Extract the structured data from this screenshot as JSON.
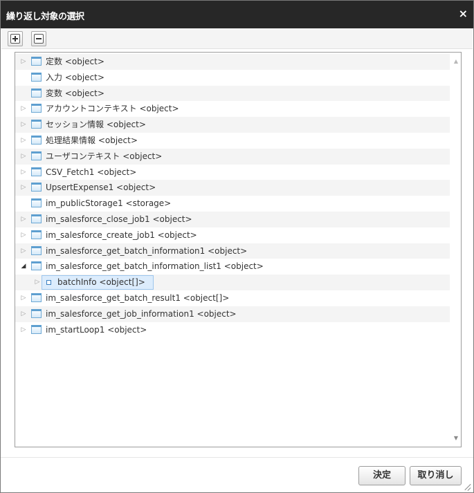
{
  "dialog": {
    "title": "繰り返し対象の選択",
    "close_glyph": "×"
  },
  "toolbar": {
    "expand_icon": "plus-box-icon",
    "collapse_icon": "minus-box-icon"
  },
  "tree": {
    "items": [
      {
        "label": "定数 <object>",
        "expander": "▷"
      },
      {
        "label": "入力 <object>",
        "expander": ""
      },
      {
        "label": "変数 <object>",
        "expander": ""
      },
      {
        "label": "アカウントコンテキスト <object>",
        "expander": "▷"
      },
      {
        "label": "セッション情報 <object>",
        "expander": "▷"
      },
      {
        "label": "処理結果情報 <object>",
        "expander": "▷"
      },
      {
        "label": "ユーザコンテキスト <object>",
        "expander": "▷"
      },
      {
        "label": "CSV_Fetch1 <object>",
        "expander": "▷"
      },
      {
        "label": "UpsertExpense1 <object>",
        "expander": "▷"
      },
      {
        "label": "im_publicStorage1 <storage>",
        "expander": ""
      },
      {
        "label": "im_salesforce_close_job1 <object>",
        "expander": "▷"
      },
      {
        "label": "im_salesforce_create_job1 <object>",
        "expander": "▷"
      },
      {
        "label": "im_salesforce_get_batch_information1 <object>",
        "expander": "▷"
      },
      {
        "label": "im_salesforce_get_batch_information_list1 <object>",
        "expander": "◢"
      },
      {
        "label": "batchInfo <object[]>",
        "expander": "▷"
      },
      {
        "label": "im_salesforce_get_batch_result1 <object[]>",
        "expander": "▷"
      },
      {
        "label": "im_salesforce_get_job_information1 <object>",
        "expander": "▷"
      },
      {
        "label": "im_startLoop1 <object>",
        "expander": "▷"
      }
    ]
  },
  "scroll": {
    "up": "▲",
    "down": "▼"
  },
  "footer": {
    "ok_label": "決定",
    "cancel_label": "取り消し"
  },
  "colors": {
    "titlebar": "#272727",
    "selection": "#dcecfc",
    "folder": "#6da8d4"
  }
}
